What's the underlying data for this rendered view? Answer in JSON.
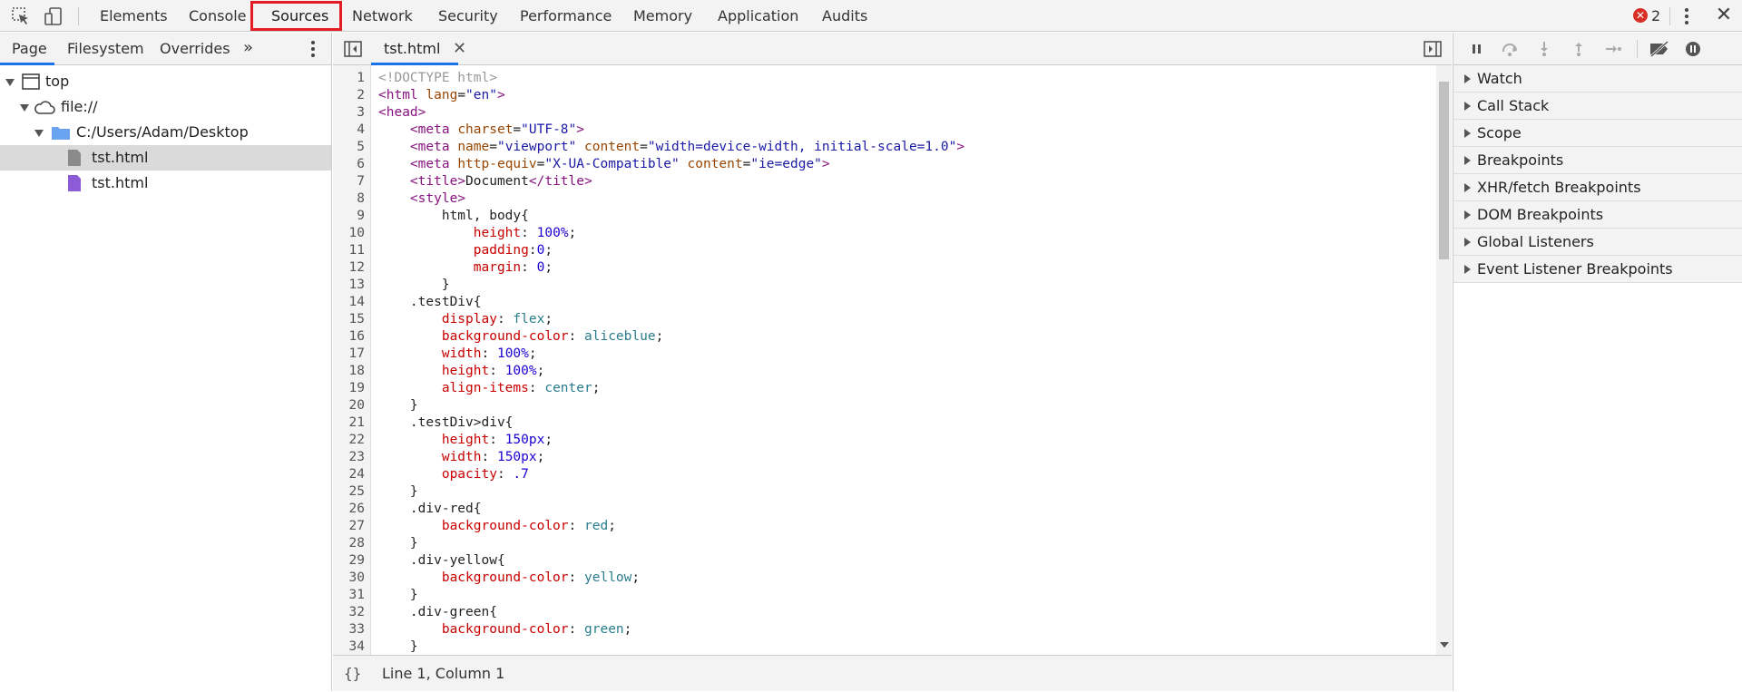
{
  "toolbar": {
    "tabs": [
      "Elements",
      "Console",
      "Sources",
      "Network",
      "Security",
      "Performance",
      "Memory",
      "Application",
      "Audits"
    ],
    "active_tab": "Sources",
    "error_count": "2",
    "error_glyph": "✕",
    "close_glyph": "✕"
  },
  "navigator": {
    "tabs": [
      "Page",
      "Filesystem",
      "Overrides"
    ],
    "more_glyph": "»",
    "tree": {
      "top": "top",
      "origin": "file://",
      "folder": "C:/Users/Adam/Desktop",
      "files": [
        "tst.html",
        "tst.html"
      ]
    }
  },
  "editor": {
    "tab_label": "tst.html",
    "tab_close": "✕",
    "status_braces": "{}",
    "status_text": "Line 1, Column 1",
    "lines": [
      "<!DOCTYPE html>",
      "<html lang=\"en\">",
      "<head>",
      "    <meta charset=\"UTF-8\">",
      "    <meta name=\"viewport\" content=\"width=device-width, initial-scale=1.0\">",
      "    <meta http-equiv=\"X-UA-Compatible\" content=\"ie=edge\">",
      "    <title>Document</title>",
      "    <style>",
      "        html, body{",
      "            height: 100%;",
      "            padding:0;",
      "            margin: 0;",
      "        }",
      "    .testDiv{",
      "        display: flex;",
      "        background-color: aliceblue;",
      "        width: 100%;",
      "        height: 100%;",
      "        align-items: center;",
      "    }",
      "    .testDiv>div{",
      "        height: 150px;",
      "        width: 150px;",
      "        opacity: .7",
      "    }",
      "    .div-red{",
      "        background-color: red;",
      "    }",
      "    .div-yellow{",
      "        background-color: yellow;",
      "    }",
      "    .div-green{",
      "        background-color: green;",
      "    }"
    ]
  },
  "debugger": {
    "panes": [
      "Watch",
      "Call Stack",
      "Scope",
      "Breakpoints",
      "XHR/fetch Breakpoints",
      "DOM Breakpoints",
      "Global Listeners",
      "Event Listener Breakpoints"
    ]
  },
  "colors": {
    "highlight": "#e51c23",
    "active_underline": "#1a73e8",
    "folder": "#6aa4f0",
    "file_gray": "#8a8a8a",
    "file_purple": "#8e5bd6",
    "error": "#d93025"
  }
}
